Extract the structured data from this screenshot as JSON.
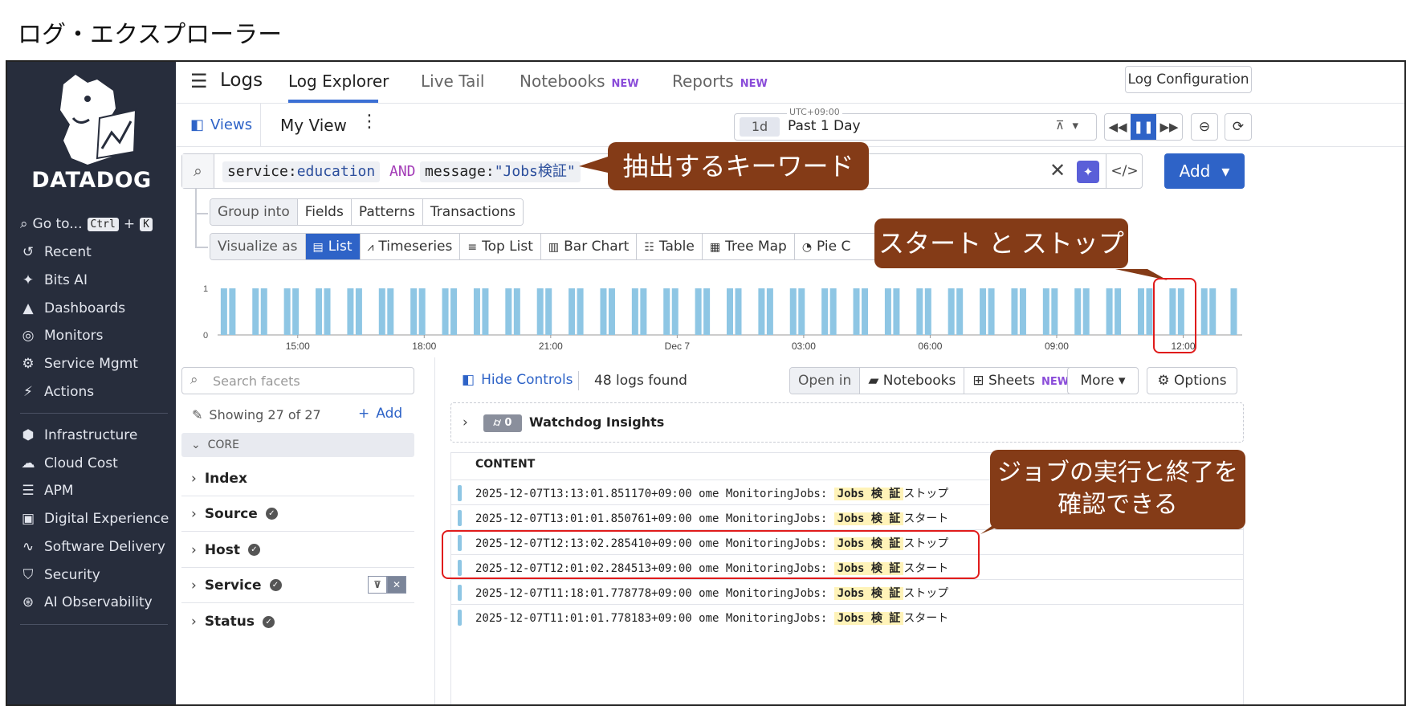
{
  "page_title": "ログ・エクスプローラー",
  "sidebar": {
    "brand": "DATADOG",
    "goto_label": "Go to...",
    "goto_keys": [
      "Ctrl",
      "+",
      "K"
    ],
    "items": [
      {
        "label": "Recent",
        "icon": "history-icon"
      },
      {
        "label": "Bits AI",
        "icon": "sparkle-icon"
      },
      {
        "label": "Dashboards",
        "icon": "chart-area-icon"
      },
      {
        "label": "Monitors",
        "icon": "radar-icon"
      },
      {
        "label": "Service Mgmt",
        "icon": "service-icon"
      },
      {
        "label": "Actions",
        "icon": "bolt-icon"
      },
      {
        "label": "Infrastructure",
        "icon": "hexagon-nodes-icon"
      },
      {
        "label": "Cloud Cost",
        "icon": "cloud-dollar-icon"
      },
      {
        "label": "APM",
        "icon": "apm-icon"
      },
      {
        "label": "Digital Experience",
        "icon": "browser-icon"
      },
      {
        "label": "Software Delivery",
        "icon": "pipeline-icon"
      },
      {
        "label": "Security",
        "icon": "shield-icon"
      },
      {
        "label": "AI Observability",
        "icon": "ai-icon"
      }
    ]
  },
  "topbar": {
    "title": "Logs",
    "tabs": [
      {
        "label": "Log Explorer",
        "new": ""
      },
      {
        "label": "Live Tail",
        "new": ""
      },
      {
        "label": "Notebooks",
        "new": "NEW"
      },
      {
        "label": "Reports",
        "new": "NEW"
      }
    ],
    "config_button": "Log Configuration"
  },
  "viewbar": {
    "views": "Views",
    "my_view": "My View",
    "timezone": "UTC+09:00",
    "range_short": "1d",
    "range_label": "Past 1 Day"
  },
  "search": {
    "q1_key": "service:",
    "q1_val": "education",
    "op": "AND",
    "q2_key": "message:",
    "q2_val": "\"Jobs検証\"",
    "add_button": "Add"
  },
  "group_into": {
    "label": "Group into",
    "options": [
      "Fields",
      "Patterns",
      "Transactions"
    ]
  },
  "visualize_as": {
    "label": "Visualize as",
    "options": [
      {
        "label": "List",
        "icon": "list-icon"
      },
      {
        "label": "Timeseries",
        "icon": "timeseries-icon"
      },
      {
        "label": "Top List",
        "icon": "toplist-icon"
      },
      {
        "label": "Bar Chart",
        "icon": "bar-chart-icon"
      },
      {
        "label": "Table",
        "icon": "table-icon"
      },
      {
        "label": "Tree Map",
        "icon": "treemap-icon"
      },
      {
        "label": "Pie C",
        "icon": "pie-icon"
      }
    ]
  },
  "chart_data": {
    "type": "bar",
    "ylim": [
      0,
      1
    ],
    "yticks": [
      "1",
      "0"
    ],
    "xticks": [
      "15:00",
      "18:00",
      "21:00",
      "Dec 7",
      "03:00",
      "06:00",
      "09:00",
      "12:00"
    ],
    "x_range_hours": [
      13.1,
      37.4
    ],
    "bar_times_hours": [
      13.25,
      13.45,
      14.0,
      14.2,
      14.75,
      14.95,
      15.5,
      15.7,
      16.25,
      16.45,
      17.0,
      17.2,
      17.75,
      17.95,
      18.5,
      18.7,
      19.25,
      19.45,
      20.0,
      20.2,
      20.75,
      20.95,
      21.5,
      21.7,
      22.25,
      22.45,
      23.0,
      23.2,
      23.75,
      23.95,
      24.5,
      24.7,
      25.25,
      25.45,
      26.0,
      26.2,
      26.75,
      26.95,
      27.5,
      27.7,
      28.25,
      28.45,
      29.0,
      29.2,
      29.75,
      29.95,
      30.5,
      30.7,
      31.25,
      31.45,
      32.0,
      32.2,
      32.75,
      32.95,
      33.5,
      33.7,
      34.25,
      34.45,
      35.0,
      35.2,
      35.75,
      35.95,
      36.5,
      36.7,
      37.2
    ],
    "values_all": 1
  },
  "facets": {
    "search_placeholder": "Search facets",
    "showing": "Showing 27 of 27",
    "add": "Add",
    "section": "CORE",
    "items": [
      "Index",
      "Source",
      "Host",
      "Service",
      "Status"
    ]
  },
  "results": {
    "hide_controls": "Hide Controls",
    "count": "48 logs found",
    "open_in": "Open in",
    "notebooks": "Notebooks",
    "sheets": "Sheets",
    "sheets_new": "NEW",
    "more": "More",
    "options": "Options",
    "watchdog_count": "0",
    "watchdog": "Watchdog Insights",
    "column": "CONTENT",
    "rows": [
      {
        "prefix": "2025-12-07T13:13:01.851170+09:00 ome MonitoringJobs:",
        "hl": "Jobs 検 証",
        "suffix": "ストップ"
      },
      {
        "prefix": "2025-12-07T13:01:01.850761+09:00 ome MonitoringJobs:",
        "hl": "Jobs 検 証",
        "suffix": "スタート"
      },
      {
        "prefix": "2025-12-07T12:13:02.285410+09:00 ome MonitoringJobs:",
        "hl": "Jobs 検 証",
        "suffix": "ストップ"
      },
      {
        "prefix": "2025-12-07T12:01:02.284513+09:00 ome MonitoringJobs:",
        "hl": "Jobs 検 証",
        "suffix": "スタート"
      },
      {
        "prefix": "2025-12-07T11:18:01.778778+09:00 ome MonitoringJobs:",
        "hl": "Jobs 検 証",
        "suffix": "ストップ"
      },
      {
        "prefix": "2025-12-07T11:01:01.778183+09:00 ome MonitoringJobs:",
        "hl": "Jobs 検 証",
        "suffix": "スタート"
      }
    ]
  },
  "annotations": {
    "keyword": "抽出するキーワード",
    "start_stop": "スタート と ストップ",
    "confirm_line1": "ジョブの実行と終了を",
    "confirm_line2": "確認できる"
  },
  "colors": {
    "accent": "#2e63c7",
    "sidebar": "#272d3c",
    "callout": "#843b17",
    "highlight_box": "#e01b1b",
    "bar": "#8ec6e4"
  }
}
